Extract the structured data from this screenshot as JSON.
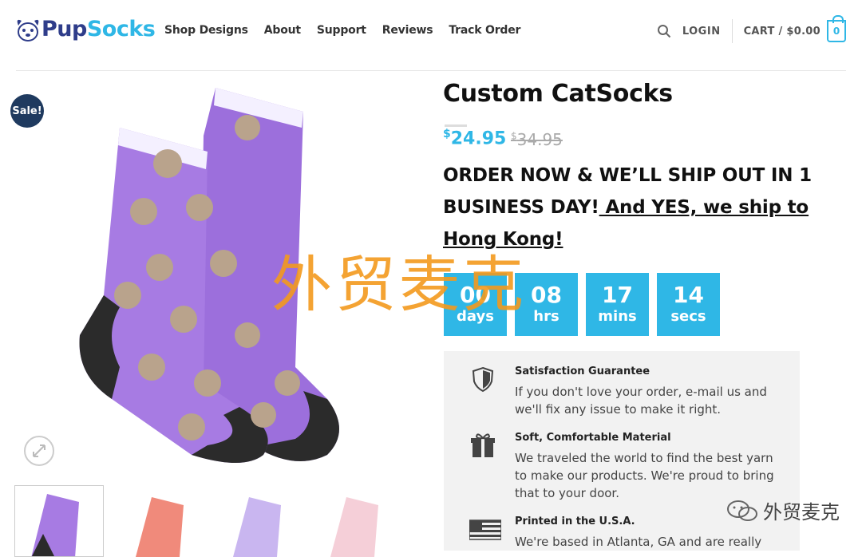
{
  "brand": {
    "part1": "Pup",
    "part2": "Socks"
  },
  "nav": {
    "items": [
      "Shop Designs",
      "About",
      "Support",
      "Reviews",
      "Track Order"
    ]
  },
  "header": {
    "login": "LOGIN",
    "cart": "CART / $0.00",
    "cart_count": "0"
  },
  "product": {
    "sale_badge": "Sale!",
    "title": "Custom CatSocks",
    "price_symbol": "$",
    "price": "24.95",
    "old_price_symbol": "$",
    "old_price": "34.95",
    "ship_text": "ORDER NOW & WE’LL SHIP OUT IN 1 BUSINESS DAY!",
    "ship_link": " And YES, we ship to Hong Kong!"
  },
  "countdown": [
    {
      "num": "00",
      "label": "days"
    },
    {
      "num": "08",
      "label": "hrs"
    },
    {
      "num": "17",
      "label": "mins"
    },
    {
      "num": "14",
      "label": "secs"
    }
  ],
  "guarantees": [
    {
      "icon": "shield-icon",
      "title": "Satisfaction Guarantee",
      "desc": "If you don't love your order, e-mail us and we'll fix any issue to make it right."
    },
    {
      "icon": "gift-icon",
      "title": "Soft, Comfortable Material",
      "desc": "We traveled the world to find the best yarn to make our products. We're proud to bring that to your door."
    },
    {
      "icon": "us-flag-icon",
      "title": "Printed in the U.S.A.",
      "desc": "We're based in Atlanta, GA and are really"
    }
  ],
  "watermark": {
    "main": "外贸麦克",
    "corner": "外贸麦克"
  },
  "colors": {
    "accent": "#2fb7e6",
    "navy": "#1f3a5f",
    "sock": "#a77be3",
    "watermark": "#f39a1e"
  }
}
